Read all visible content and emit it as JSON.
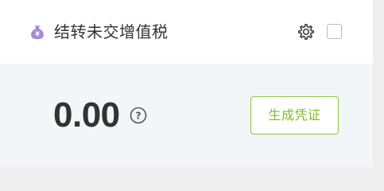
{
  "card": {
    "title": "结转未交增值税",
    "amount": "0.00",
    "action_label": "生成凭证",
    "checkbox_checked": false,
    "icons": {
      "title_icon": "money-bag-yuan-icon",
      "settings": "gear-icon",
      "help": "question-circle-icon"
    },
    "colors": {
      "title_icon": "#a58ad8",
      "action": "#7cbb2b",
      "action_border": "#8cc43a",
      "body_bg": "#f2f6f8"
    }
  }
}
